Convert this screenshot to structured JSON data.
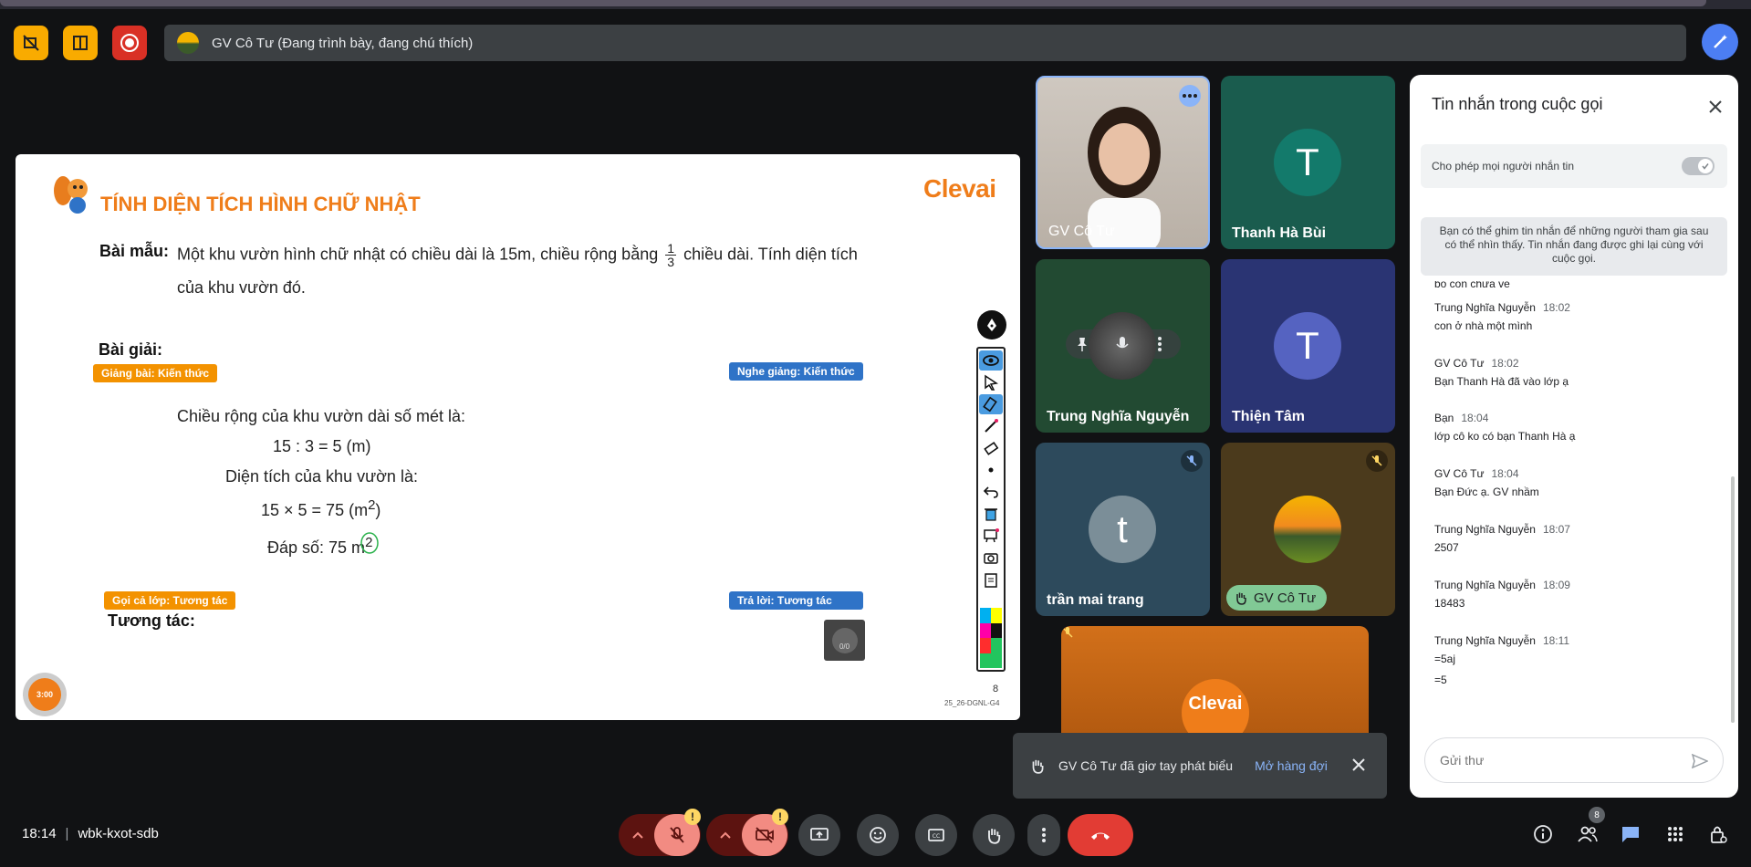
{
  "presenter": {
    "label": "GV Cô Tư (Đang trình bày, đang chú thích)"
  },
  "slide": {
    "brand": "Clevai",
    "title": "TÍNH DIỆN TÍCH HÌNH CHỮ NHẬT",
    "example_label": "Bài mẫu:",
    "example_text_a": "Một khu vườn hình chữ nhật có chiều dài là 15m, chiều rộng bằng",
    "frac_num": "1",
    "frac_den": "3",
    "example_text_b": "chiều dài. Tính diện tích",
    "example_text_c": "của khu vườn đó.",
    "solution_label": "Bài giải:",
    "tag_teach": "Giảng bài: Kiến thức",
    "tag_listen": "Nghe giảng: Kiến thức",
    "line1": "Chiều rộng của khu vườn dài số mét là:",
    "line2": "15 : 3 = 5 (m)",
    "line3": "Diện tích của khu vườn là:",
    "line4_a": "15 × 5 = 75 (m",
    "line4_sup": "2",
    "line4_b": ")",
    "line5_a": "Đáp số: 75 m",
    "line5_sup": "2",
    "tag_call": "Gọi cả lớp: Tương tác",
    "tag_answer": "Trả lời: Tương tác",
    "interact_label": "Tương tác:",
    "qr_count": "0/0",
    "page_number": "8",
    "page_code": "25_26-DGNL-G4",
    "timer": "3:00"
  },
  "participants": [
    {
      "name": "GV Cô Tư",
      "type": "video"
    },
    {
      "name": "Thanh Hà Bùi",
      "initial": "T",
      "bg": "#1a5c4e",
      "circle": "#137a6b"
    },
    {
      "name": "Trung Nghĩa Nguyễn",
      "type": "photo"
    },
    {
      "name": "Thiện Tâm",
      "initial": "T",
      "bg": "#2a3473",
      "circle": "#5563c1"
    },
    {
      "name": "trần mai trang",
      "initial": "t",
      "bg": "#2d4a5c",
      "circle": "#7b8e98"
    },
    {
      "name": "GV Cô Tư",
      "type": "hand"
    },
    {
      "name": "Clevai",
      "type": "logo"
    }
  ],
  "chat": {
    "title": "Tin nhắn trong cuộc gọi",
    "permission": "Cho phép mọi người nhắn tin",
    "info": "Bạn có thể ghim tin nhắn để những người tham gia sau có thể nhìn thấy. Tin nhắn đang được ghi lại cùng với cuộc gọi.",
    "partial": "bố con chưa về",
    "messages": [
      {
        "sender": "Trung Nghĩa Nguyễn",
        "time": "18:02",
        "text": "con ở nhà một mình"
      },
      {
        "sender": "GV Cô Tư",
        "time": "18:02",
        "text": "Bạn Thanh Hà đã vào lớp ạ"
      },
      {
        "sender": "Bạn",
        "time": "18:04",
        "text": "lớp cô ko có bạn Thanh Hà ạ"
      },
      {
        "sender": "GV Cô Tư",
        "time": "18:04",
        "text": "Bạn Đức ạ. GV nhầm"
      },
      {
        "sender": "Trung Nghĩa Nguyễn",
        "time": "18:07",
        "text": "2507"
      },
      {
        "sender": "Trung Nghĩa Nguyễn",
        "time": "18:09",
        "text": "18483"
      },
      {
        "sender": "Trung Nghĩa Nguyễn",
        "time": "18:11",
        "text": "=5aj",
        "text2": "=5"
      }
    ],
    "input_placeholder": "Gửi thư"
  },
  "toast": {
    "text": "GV Cô Tư đã giơ tay phát biểu",
    "link": "Mở hàng đợi"
  },
  "bottom": {
    "time": "18:14",
    "sep": "|",
    "meeting_code": "wbk-kxot-sdb",
    "people_count": "8"
  }
}
